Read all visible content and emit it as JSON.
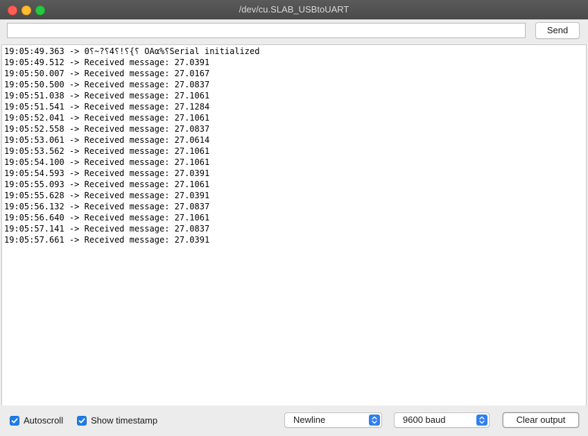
{
  "window": {
    "title": "/dev/cu.SLAB_USBtoUART"
  },
  "input": {
    "value": "",
    "placeholder": "",
    "send_label": "Send"
  },
  "output": {
    "lines": [
      "19:05:49.363 -> 0⸮~?⸮4⸮!⸮{⸮ OAα%⸮Serial initialized",
      "19:05:49.512 -> Received message: 27.0391",
      "19:05:50.007 -> Received message: 27.0167",
      "19:05:50.500 -> Received message: 27.0837",
      "19:05:51.038 -> Received message: 27.1061",
      "19:05:51.541 -> Received message: 27.1284",
      "19:05:52.041 -> Received message: 27.1061",
      "19:05:52.558 -> Received message: 27.0837",
      "19:05:53.061 -> Received message: 27.0614",
      "19:05:53.562 -> Received message: 27.1061",
      "19:05:54.100 -> Received message: 27.1061",
      "19:05:54.593 -> Received message: 27.0391",
      "19:05:55.093 -> Received message: 27.1061",
      "19:05:55.628 -> Received message: 27.0391",
      "19:05:56.132 -> Received message: 27.0837",
      "19:05:56.640 -> Received message: 27.1061",
      "19:05:57.141 -> Received message: 27.0837",
      "19:05:57.661 -> Received message: 27.0391"
    ]
  },
  "bottom": {
    "autoscroll": {
      "label": "Autoscroll",
      "checked": true
    },
    "show_timestamp": {
      "label": "Show timestamp",
      "checked": true
    },
    "line_ending": {
      "selected": "Newline"
    },
    "baud": {
      "selected": "9600 baud"
    },
    "clear_label": "Clear output"
  },
  "colors": {
    "accent": "#1f7ce8",
    "close": "#fe5f57",
    "minimize": "#febc2e",
    "maximize": "#28c840"
  }
}
